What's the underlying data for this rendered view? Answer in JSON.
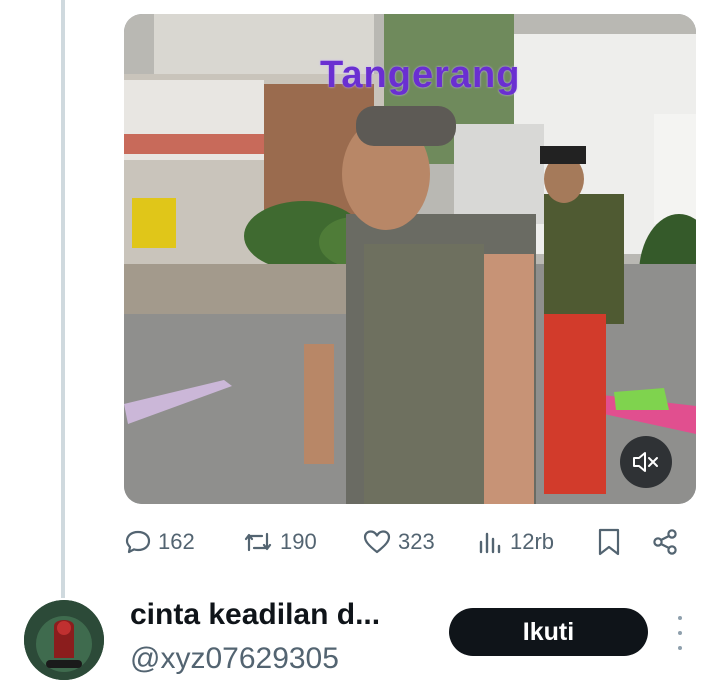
{
  "post": {
    "video": {
      "watermark": "Tangerang",
      "mute_icon": "speaker-muted-icon"
    },
    "actions": {
      "replies": "162",
      "reposts": "190",
      "likes": "323",
      "views": "12rb"
    },
    "icons": {
      "reply": "comment-bubble-icon",
      "repost": "repost-icon",
      "like": "heart-icon",
      "views": "bar-chart-icon",
      "bookmark": "bookmark-icon",
      "share": "share-icon"
    }
  },
  "suggested_user": {
    "display_name": "cinta keadilan d...",
    "handle": "@xyz07629305",
    "follow_label": "Ikuti"
  },
  "colors": {
    "text_primary": "#0f1419",
    "text_secondary": "#536471",
    "thread_line": "#cfd9de",
    "watermark": "#6a2fd1",
    "follow_button_bg": "#0f1419"
  }
}
